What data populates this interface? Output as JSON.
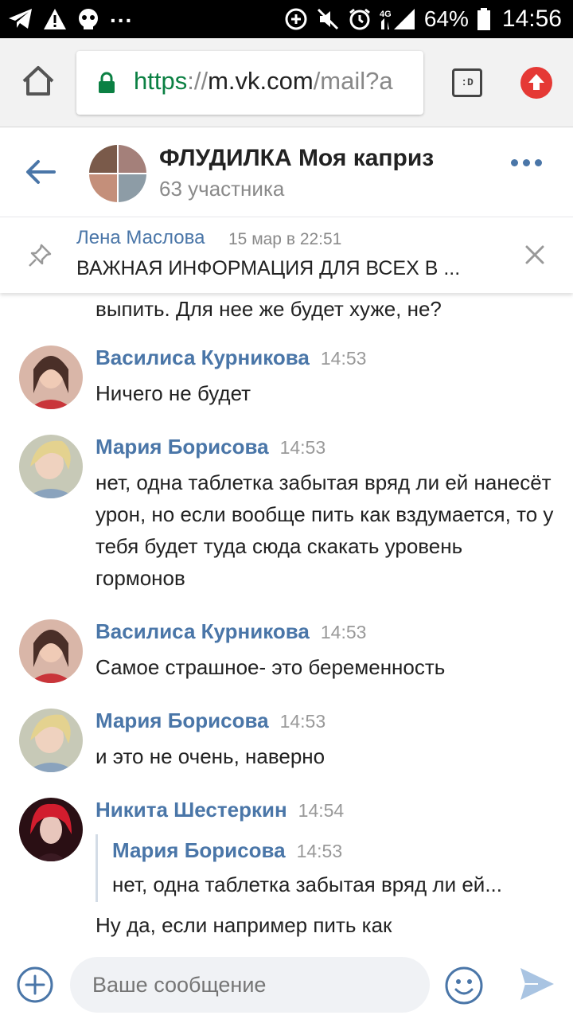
{
  "statusbar": {
    "battery": "64%",
    "time": "14:56",
    "signal_label": "4G",
    "dots": "...",
    "icons": [
      "telegram-icon",
      "warning-icon",
      "mask-icon",
      "data-saver-icon",
      "mute-icon",
      "alarm-icon",
      "signal-icon",
      "battery-icon"
    ]
  },
  "browser": {
    "url_scheme": "https",
    "url_sep": "://",
    "url_host": "m.vk.com",
    "url_path": "/mail?a",
    "tabs_label": ":D"
  },
  "chat": {
    "title": "ФЛУДИЛКА Моя каприз",
    "subtitle": "63 участника"
  },
  "pinned": {
    "author": "Лена Маслова",
    "date": "15 мар в 22:51",
    "text": "ВАЖНАЯ ИНФОРМАЦИЯ ДЛЯ ВСЕХ В ..."
  },
  "messages": {
    "partial_text": "выпить. Для нее же будет хуже, не?",
    "items": [
      {
        "author": "Василиса Курникова",
        "time": "14:53",
        "text": "Ничего не будет"
      },
      {
        "author": "Мария Борисова",
        "time": "14:53",
        "text": "нет, одна таблетка забытая вряд ли ей нанесёт урон, но если вообще пить как вздумается, то у тебя будет туда сюда скакать уровень гормонов"
      },
      {
        "author": "Василиса Курникова",
        "time": "14:53",
        "text": "Самое страшное- это беременность"
      },
      {
        "author": "Мария Борисова",
        "time": "14:53",
        "text": "и это не очень, наверно"
      },
      {
        "author": "Никита Шестеркин",
        "time": "14:54",
        "text": "Ну да, если например пить как",
        "quote": {
          "author": "Мария Борисова",
          "time": "14:53",
          "text": "нет, одна таблетка забытая вряд ли ей..."
        }
      }
    ]
  },
  "composer": {
    "placeholder": "Ваше сообщение"
  },
  "colors": {
    "link": "#4a76a8",
    "secure": "#0b8043",
    "accent_red": "#e53935",
    "text": "#222222"
  }
}
